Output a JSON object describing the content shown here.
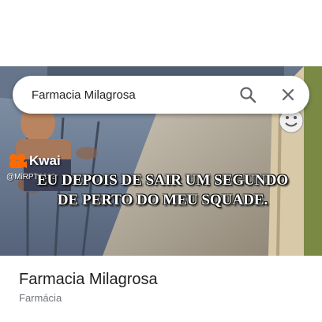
{
  "search": {
    "query": "Farmacia Milagrosa"
  },
  "icons": {
    "search": "search-icon",
    "clear": "close-icon",
    "emoji": "smiley-sticker-icon",
    "kwai": "kwai-logo-icon"
  },
  "media": {
    "watermark_brand": "Kwai",
    "watermark_handle": "@MiRPT3333",
    "caption_line1": "EU DEPOIS DE SAIR UM SEGUNDO",
    "caption_line2": "DE PERTO DO MEU SQUADE."
  },
  "place": {
    "title": "Farmacia Milagrosa",
    "category": "Farmácia"
  },
  "colors": {
    "kwai_brand": "#ff6a00",
    "title_text": "#202124",
    "secondary_text": "#70757a"
  }
}
